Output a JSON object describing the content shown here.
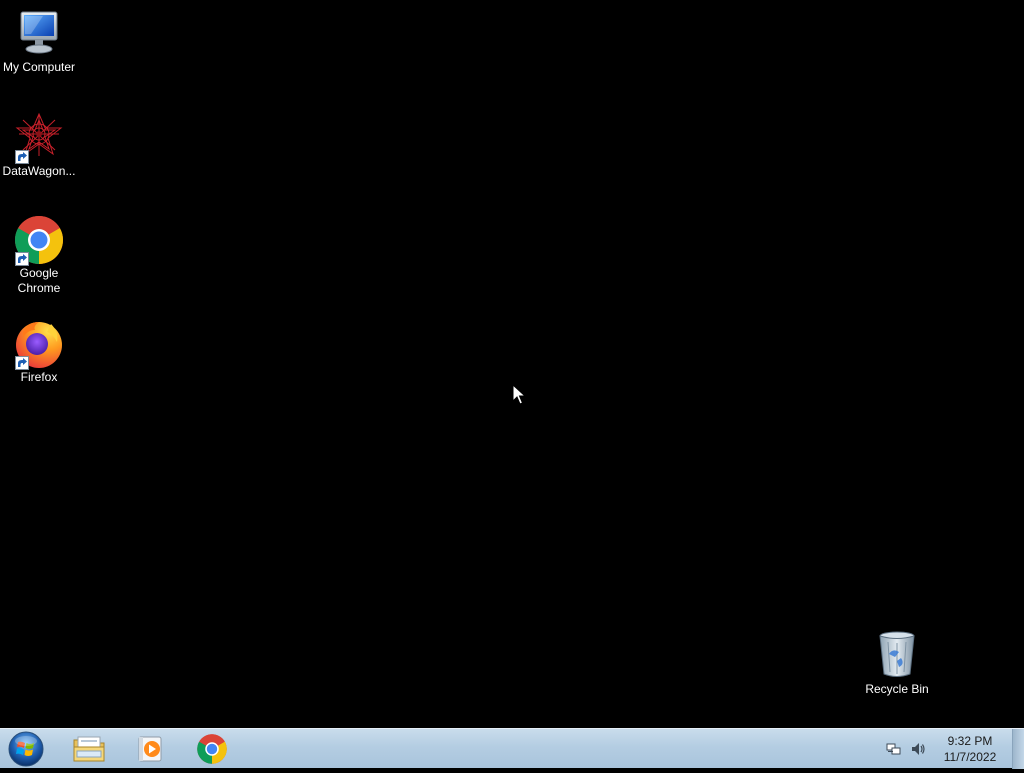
{
  "desktop": {
    "background": "#000000",
    "icons": [
      {
        "name": "my-computer",
        "label": "My Computer",
        "icon": "computer-icon"
      },
      {
        "name": "datawagon",
        "label": "DataWagon...",
        "icon": "datawagon-icon"
      },
      {
        "name": "google-chrome",
        "label": "Google Chrome",
        "icon": "chrome-icon"
      },
      {
        "name": "firefox",
        "label": "Firefox",
        "icon": "firefox-icon"
      },
      {
        "name": "recycle-bin",
        "label": "Recycle Bin",
        "icon": "recycle-bin-icon"
      }
    ]
  },
  "taskbar": {
    "pinned": [
      {
        "name": "windows-explorer",
        "icon": "folder-icon"
      },
      {
        "name": "media-player",
        "icon": "media-player-icon"
      },
      {
        "name": "chrome",
        "icon": "chrome-icon"
      }
    ],
    "tray": {
      "icons": [
        "network-icon",
        "volume-icon"
      ],
      "time": "9:32 PM",
      "date": "11/7/2022"
    }
  }
}
